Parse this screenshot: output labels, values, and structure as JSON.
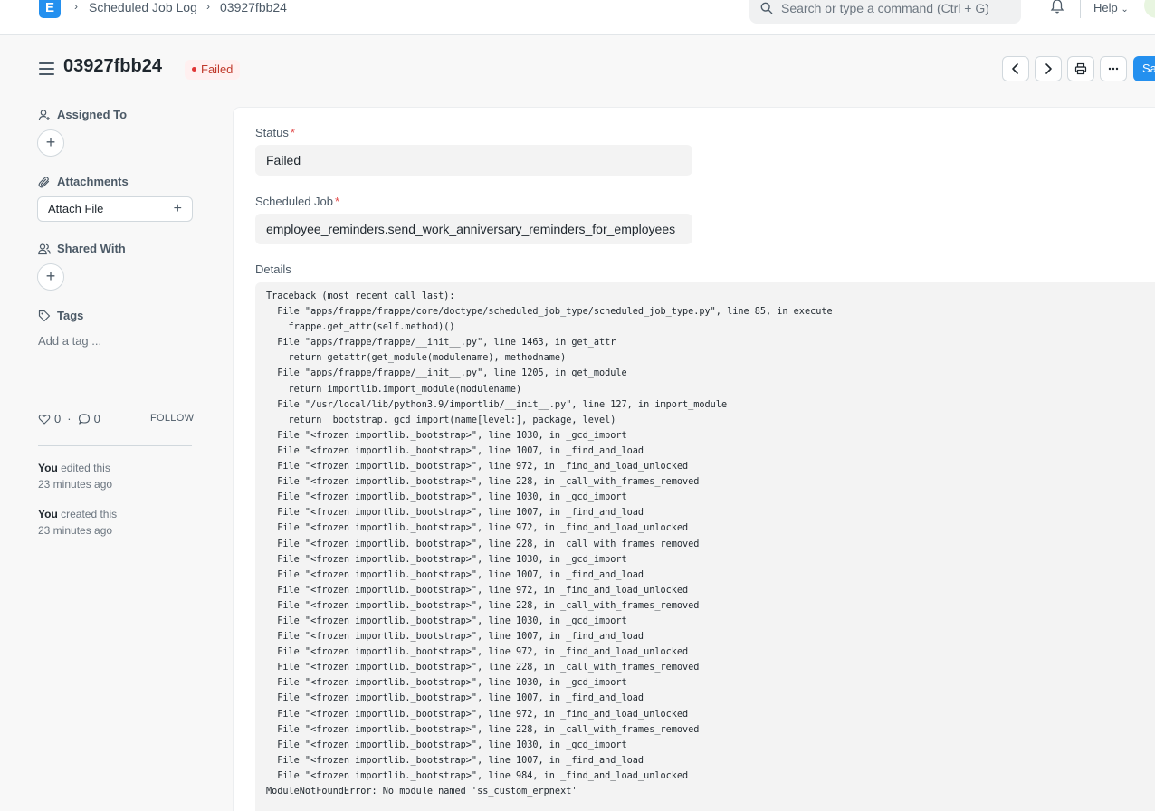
{
  "navbar": {
    "logo_letter": "E",
    "breadcrumbs": [
      "Scheduled Job Log",
      "03927fbb24"
    ],
    "search_placeholder": "Search or type a command (Ctrl + G)",
    "help_label": "Help"
  },
  "page": {
    "title": "03927fbb24",
    "status": "Failed",
    "save_label": "Sa"
  },
  "sidebar": {
    "assigned_to": "Assigned To",
    "attachments": "Attachments",
    "attach_file": "Attach File",
    "shared_with": "Shared With",
    "tags": "Tags",
    "add_tag": "Add a tag ...",
    "likes": "0",
    "comments": "0",
    "follow": "FOLLOW",
    "activity": [
      {
        "who": "You",
        "action": " edited this",
        "when": "23 minutes ago"
      },
      {
        "who": "You",
        "action": " created this",
        "when": "23 minutes ago"
      }
    ]
  },
  "form": {
    "status_label": "Status",
    "status_value": "Failed",
    "job_label": "Scheduled Job",
    "job_value": "employee_reminders.send_work_anniversary_reminders_for_employees",
    "details_label": "Details",
    "details_lines": [
      "Traceback (most recent call last):",
      "  File \"apps/frappe/frappe/core/doctype/scheduled_job_type/scheduled_job_type.py\", line 85, in execute",
      "    frappe.get_attr(self.method)()",
      "  File \"apps/frappe/frappe/__init__.py\", line 1463, in get_attr",
      "    return getattr(get_module(modulename), methodname)",
      "  File \"apps/frappe/frappe/__init__.py\", line 1205, in get_module",
      "    return importlib.import_module(modulename)",
      "  File \"/usr/local/lib/python3.9/importlib/__init__.py\", line 127, in import_module",
      "    return _bootstrap._gcd_import(name[level:], package, level)",
      "  File \"<frozen importlib._bootstrap>\", line 1030, in _gcd_import",
      "  File \"<frozen importlib._bootstrap>\", line 1007, in _find_and_load",
      "  File \"<frozen importlib._bootstrap>\", line 972, in _find_and_load_unlocked",
      "  File \"<frozen importlib._bootstrap>\", line 228, in _call_with_frames_removed",
      "  File \"<frozen importlib._bootstrap>\", line 1030, in _gcd_import",
      "  File \"<frozen importlib._bootstrap>\", line 1007, in _find_and_load",
      "  File \"<frozen importlib._bootstrap>\", line 972, in _find_and_load_unlocked",
      "  File \"<frozen importlib._bootstrap>\", line 228, in _call_with_frames_removed",
      "  File \"<frozen importlib._bootstrap>\", line 1030, in _gcd_import",
      "  File \"<frozen importlib._bootstrap>\", line 1007, in _find_and_load",
      "  File \"<frozen importlib._bootstrap>\", line 972, in _find_and_load_unlocked",
      "  File \"<frozen importlib._bootstrap>\", line 228, in _call_with_frames_removed",
      "  File \"<frozen importlib._bootstrap>\", line 1030, in _gcd_import",
      "  File \"<frozen importlib._bootstrap>\", line 1007, in _find_and_load",
      "  File \"<frozen importlib._bootstrap>\", line 972, in _find_and_load_unlocked",
      "  File \"<frozen importlib._bootstrap>\", line 228, in _call_with_frames_removed",
      "  File \"<frozen importlib._bootstrap>\", line 1030, in _gcd_import",
      "  File \"<frozen importlib._bootstrap>\", line 1007, in _find_and_load",
      "  File \"<frozen importlib._bootstrap>\", line 972, in _find_and_load_unlocked",
      "  File \"<frozen importlib._bootstrap>\", line 228, in _call_with_frames_removed",
      "  File \"<frozen importlib._bootstrap>\", line 1030, in _gcd_import",
      "  File \"<frozen importlib._bootstrap>\", line 1007, in _find_and_load",
      "  File \"<frozen importlib._bootstrap>\", line 984, in _find_and_load_unlocked",
      "ModuleNotFoundError: No module named 'ss_custom_erpnext'"
    ]
  }
}
